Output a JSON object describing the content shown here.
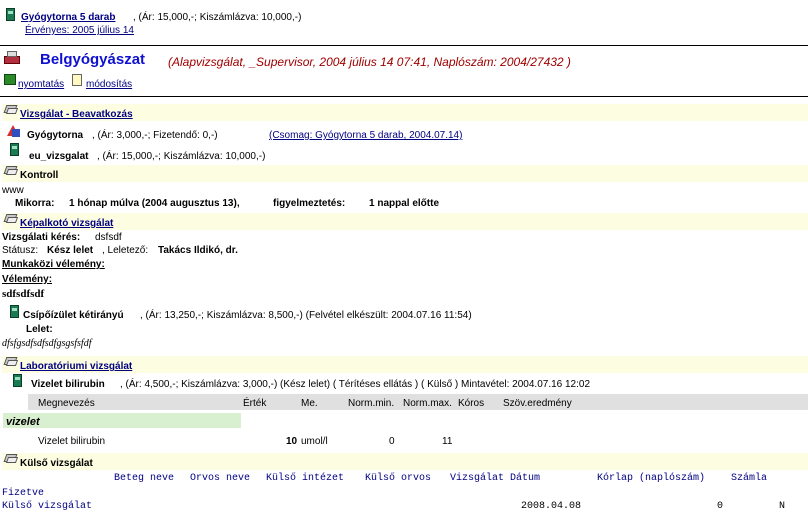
{
  "top": {
    "package_name": " Gyógytorna 5 darab",
    "package_price": ", (Ár: 15,000,-; Kiszámlázva: 10,000,-)",
    "valid_link": "Érvényes: 2005 július 14"
  },
  "header": {
    "title": "Belgyógyászat",
    "subtitle": "(Alapvizsgálat, _Supervisor, 2004 július 14  07:41, Naplószám: 2004/27432 )",
    "print_label": "nyomtatás",
    "edit_label": "módosítás"
  },
  "vizsgalat": {
    "title": "Vizsgálat - Beavatkozás",
    "item1_name": "Gyógytorna",
    "item1_info": ",  (Ár: 3,000,-;  Fizetendő: 0,-)",
    "item1_link": "(Csomag: Gyógytorna 5 darab, 2004.07.14)",
    "item2_name": "eu_vizsgalat",
    "item2_info": ",  (Ár: 15,000,-; Kiszámlázva: 10,000,-)"
  },
  "kontroll": {
    "title": "Kontroll",
    "text": "www",
    "mikorra_label": "Mikorra:",
    "mikorra_value": "1 hónap múlva (2004 augusztus 13),",
    "warn_label": "figyelmeztetés:",
    "warn_value": "1 nappal előtte"
  },
  "kepalkoto": {
    "title": "Képalkotó vizsgálat",
    "request_label": "Vizsgálati kérés:",
    "request_value": "dsfsdf",
    "status_label": "Státusz:",
    "status_value": "Kész lelet",
    "leletezo_label": ", Leletező:",
    "leletezo_value": "Takács Ildikó, dr.",
    "munkakozi": "Munkaközi vélemény:",
    "velemeny": "Vélemény:",
    "velemeny_text": "sdfsdfsdf",
    "item_name": "Csípőízület kétirányú",
    "item_info": ",  (Ár: 13,250,-; Kiszámlázva: 8,500,-)  (Felvétel elkészült: 2004.07.16 11:54)",
    "lelet_label": "Lelet:",
    "lelet_text": "dfsfgsdfsdfsdfgsgsfsfdf"
  },
  "labor": {
    "title": "Laboratóriumi vizsgálat",
    "item_name": "Vizelet bilirubin",
    "item_info": ",  (Ár: 4,500,-; Kiszámlázva: 3,000,-) (Kész lelet)  ( Térítéses ellátás )  ( Külső )  Mintavétel: 2004.07.16 12:02",
    "columns": [
      "Megnevezés",
      "Érték",
      "Me.",
      "Norm.min.",
      "Norm.max.",
      "Kóros",
      "Szöv.eredmény"
    ],
    "group": "vizelet",
    "row": {
      "name": "Vizelet bilirubin",
      "value": "10",
      "unit": "umol/l",
      "min": "0",
      "max": "11"
    }
  },
  "kulso": {
    "title": "Külső vizsgálat",
    "columns": [
      "Beteg neve",
      "Orvos neve",
      "Külső intézet",
      "Külső orvos",
      "Vizsgálat Dátum",
      "Kórlap (naplószám)",
      "Számla"
    ],
    "col_fizetve": "Fizetve",
    "row": {
      "name": "Külső vizsgálat",
      "date": "2008.04.08",
      "korlap": "0",
      "szamla": "N"
    }
  }
}
